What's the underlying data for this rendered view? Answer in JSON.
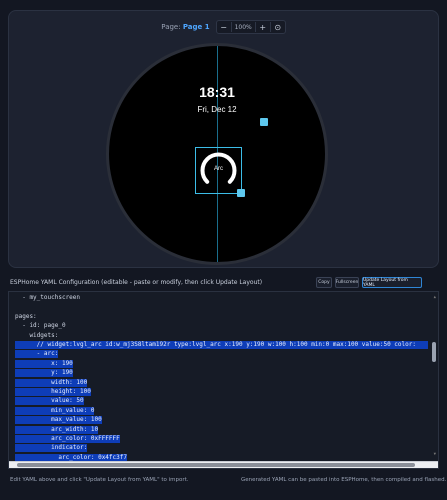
{
  "toolbar": {
    "page_prefix": "Page:",
    "page_name": "Page 1",
    "zoom_out": "−",
    "zoom_value": "100%",
    "zoom_in": "+",
    "fit": "⊙"
  },
  "screen": {
    "time": "18:31",
    "date": "Fri, Dec 12",
    "arc_label": "Arc",
    "arc_value": 50,
    "arc_min": 0,
    "arc_max": 100
  },
  "yaml_panel": {
    "title": "ESPHome YAML Configuration (editable - paste or modify, then click Update Layout)",
    "copy_label": "Copy",
    "fullscreen_label": "Fullscreen",
    "update_label": "Update Layout from YAML"
  },
  "code": {
    "lines": [
      {
        "text": "  - my_touchscreen",
        "sel": false,
        "indent": 0
      },
      {
        "text": "",
        "sel": false,
        "indent": 0
      },
      {
        "text": "pages:",
        "sel": false,
        "indent": 0
      },
      {
        "text": "  - id: page_0",
        "sel": false,
        "indent": 0
      },
      {
        "text": "    widgets:",
        "sel": false,
        "indent": 0
      },
      {
        "text": "      // widget:lvgl_arc id:w_mj3S8ltam192r type:lvgl_arc x:190 y:190 w:100 h:100 min:0 max:100 value:50 color:",
        "sel": true,
        "indent": 0
      },
      {
        "text": "      - arc:",
        "sel": true,
        "indent": 0
      },
      {
        "text": "          x: 190",
        "sel": true,
        "indent": 0
      },
      {
        "text": "          y: 190",
        "sel": true,
        "indent": 0
      },
      {
        "text": "          width: 100",
        "sel": true,
        "indent": 0
      },
      {
        "text": "          height: 100",
        "sel": true,
        "indent": 0
      },
      {
        "text": "          value: 50",
        "sel": true,
        "indent": 0
      },
      {
        "text": "          min_value: 0",
        "sel": true,
        "indent": 0
      },
      {
        "text": "          max_value: 100",
        "sel": true,
        "indent": 0
      },
      {
        "text": "          arc_width: 10",
        "sel": true,
        "indent": 0
      },
      {
        "text": "          arc_color: 0xFFFFFF",
        "sel": true,
        "indent": 0
      },
      {
        "text": "          indicator:",
        "sel": true,
        "indent": 0
      },
      {
        "text": "            arc_color: 0x4fc3f7",
        "sel": true,
        "indent": 0
      }
    ]
  },
  "footer": {
    "left": "Edit YAML above and click \"Update Layout from YAML\" to import.",
    "right": "Generated YAML can be pasted into ESPHome, then compiled and flashed."
  }
}
